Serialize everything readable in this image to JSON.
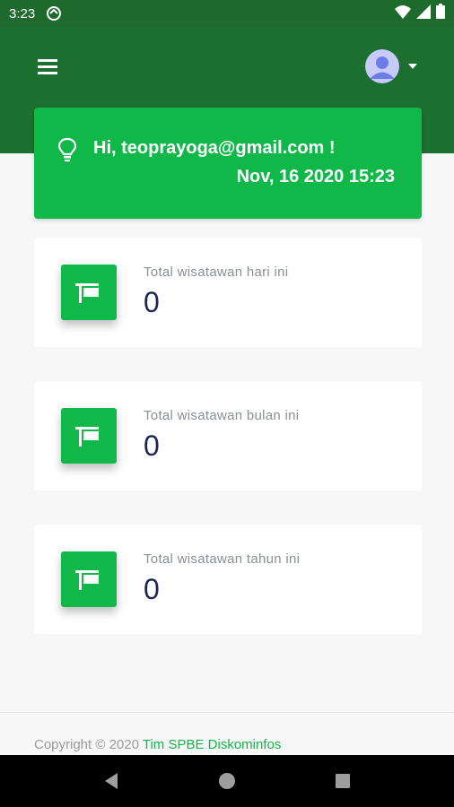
{
  "status_bar": {
    "time": "3:23",
    "icons": [
      "sync-icon",
      "wifi-icon",
      "signal-icon",
      "battery-icon"
    ]
  },
  "header": {
    "menu_icon": "menu-icon",
    "avatar_icon": "user-avatar-icon",
    "caret_icon": "caret-down-icon"
  },
  "welcome": {
    "icon": "lightbulb-icon",
    "greeting": "Hi, teoprayoga@gmail.com !",
    "datetime": "Nov, 16 2020 15:23"
  },
  "stats": [
    {
      "label": "Total wisatawan hari ini",
      "value": "0",
      "icon": "flag-icon"
    },
    {
      "label": "Total wisatawan bulan ini",
      "value": "0",
      "icon": "flag-icon"
    },
    {
      "label": "Total wisatawan tahun ini",
      "value": "0",
      "icon": "flag-icon"
    }
  ],
  "footer": {
    "copyright": "Copyright © 2020 ",
    "link": "Tim SPBE Diskominfos"
  },
  "nav": [
    "back-icon",
    "home-icon",
    "recents-icon"
  ],
  "colors": {
    "header_green": "#1d6f30",
    "accent_green": "#10b749",
    "value_navy": "#1d2552"
  }
}
